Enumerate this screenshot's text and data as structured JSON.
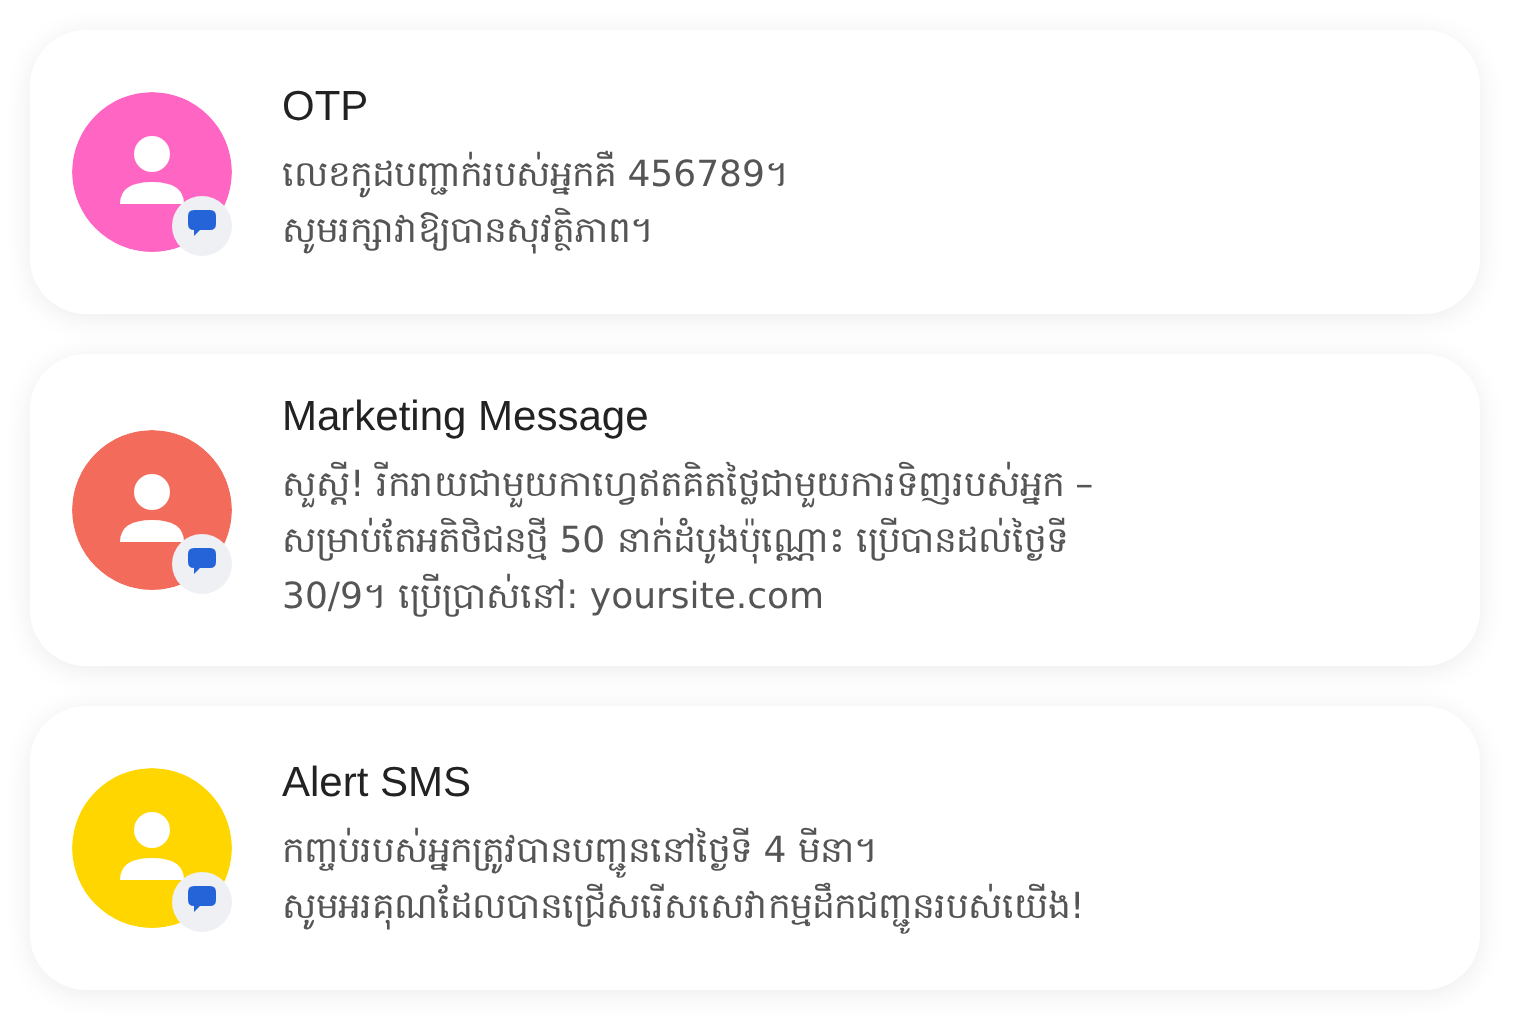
{
  "messages": [
    {
      "title": "OTP",
      "color": "#ff66c4",
      "lines": [
        "លេខកូដបញ្ជាក់របស់អ្នកគឺ 456789។",
        "សូមរក្សាវាឱ្យបានសុវត្ថិភាព។"
      ]
    },
    {
      "title": "Marketing Message",
      "color": "#f26b5b",
      "lines": [
        "សួស្តី! រីករាយជាមួយកាហ្វេឥតគិតថ្លៃជាមួយការទិញរបស់អ្នក –",
        "សម្រាប់តែអតិថិជនថ្មី 50 នាក់ដំបូងប៉ុណ្ណោះ ប្រើបានដល់ថ្ងៃទី",
        "30/9។ ប្រើប្រាស់នៅ: yoursite.com"
      ]
    },
    {
      "title": "Alert SMS",
      "color": "#ffd600",
      "lines": [
        "កញ្ចប់របស់អ្នកត្រូវបានបញ្ជូននៅថ្ងៃទី 4 មីនា។",
        "សូមអរគុណដែលបានជ្រើសរើសសេវាកម្មដឹកជញ្ជូនរបស់យើង!"
      ]
    }
  ]
}
